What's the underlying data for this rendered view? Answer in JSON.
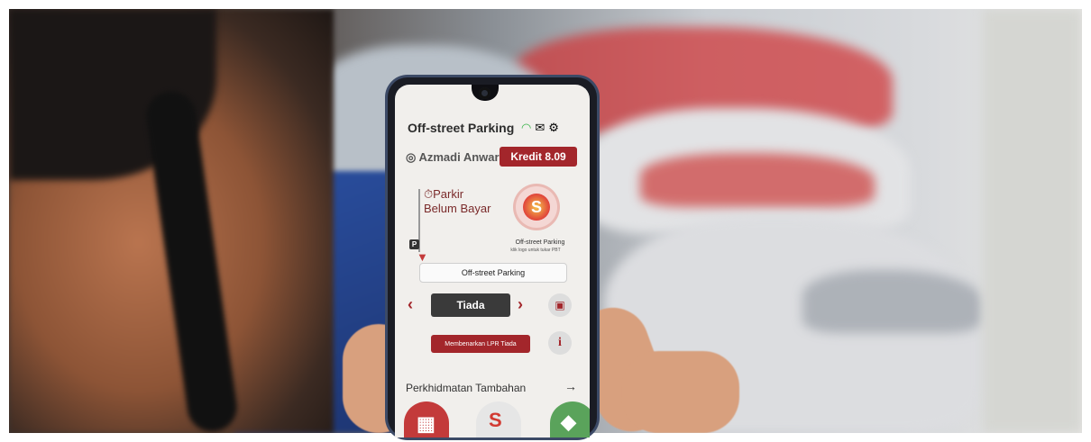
{
  "app": {
    "title": "Off-street Parking",
    "user_name": "Azmadi Anwar",
    "kredit": "Kredit 8.09"
  },
  "parking": {
    "status_line1": "Parkir",
    "status_line2": "Belum Bayar",
    "logo_label": "Off-street Parking",
    "logo_sub": "klik logo untuk tukar PBT",
    "location": "Off-street Parking",
    "vehicle": "Tiada",
    "lpr_button": "Membenarkan LPR Tiada"
  },
  "extra": {
    "title": "Perkhidmatan Tambahan"
  },
  "colors": {
    "brand_red": "#a3262b",
    "wifi_green": "#3ab34a"
  },
  "icons": [
    "wifi-icon",
    "mail-icon",
    "gear-icon",
    "timer-icon",
    "parking-icon",
    "location-pin-icon",
    "car-icon",
    "info-icon",
    "chevron-left-icon",
    "chevron-right-icon",
    "arrow-right-icon"
  ]
}
